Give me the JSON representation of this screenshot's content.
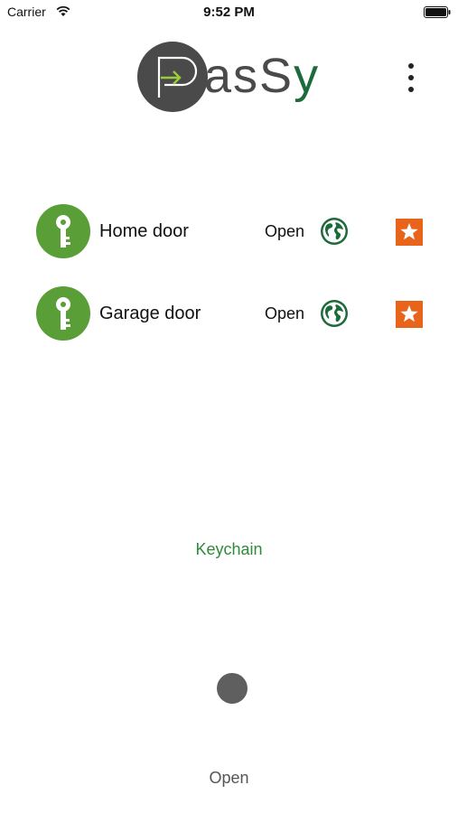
{
  "status_bar": {
    "carrier": "Carrier",
    "time": "9:52 PM"
  },
  "header": {
    "logo_text_grey": "asS",
    "logo_text_green": "y",
    "logo_icon": "passy-logo",
    "menu_icon": "more-vertical-icon"
  },
  "doors": [
    {
      "name": "Home door",
      "action_label": "Open",
      "icon": "key-icon",
      "globe_icon": "globe-icon",
      "favorite_icon": "star-icon"
    },
    {
      "name": "Garage door",
      "action_label": "Open",
      "icon": "key-icon",
      "globe_icon": "globe-icon",
      "favorite_icon": "star-icon"
    }
  ],
  "keychain_label": "Keychain",
  "bottom_label": "Open",
  "colors": {
    "brand_green": "#5a9e37",
    "dark_green": "#1d6b3a",
    "link_green": "#2f8a3a",
    "accent_orange": "#e8641b",
    "logo_grey": "#4a4a4a"
  }
}
